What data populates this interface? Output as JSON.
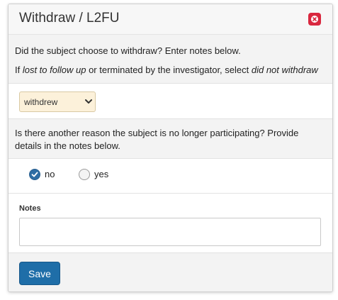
{
  "dialog": {
    "title": "Withdraw / L2FU",
    "close_icon": "close-icon",
    "accent_close": "#d9283f"
  },
  "withdraw_section": {
    "question": "Did the subject choose to withdraw? Enter notes below.",
    "hint_prefix": "If ",
    "hint_em1": "lost to follow up",
    "hint_middle": " or terminated by the investigator, select ",
    "hint_em2": "did not withdraw"
  },
  "withdraw_select": {
    "value": "withdrew",
    "icon": "chevron-down-icon"
  },
  "reason_section": {
    "question_line1": "Is there another reason the subject is no longer participating? Provide",
    "question_line2": "details in the notes below."
  },
  "reason_radio": {
    "options": [
      {
        "label": "no",
        "checked": true
      },
      {
        "label": "yes",
        "checked": false
      }
    ]
  },
  "notes": {
    "label": "Notes",
    "value": ""
  },
  "footer": {
    "save_label": "Save",
    "save_color": "#1f6ea8"
  }
}
